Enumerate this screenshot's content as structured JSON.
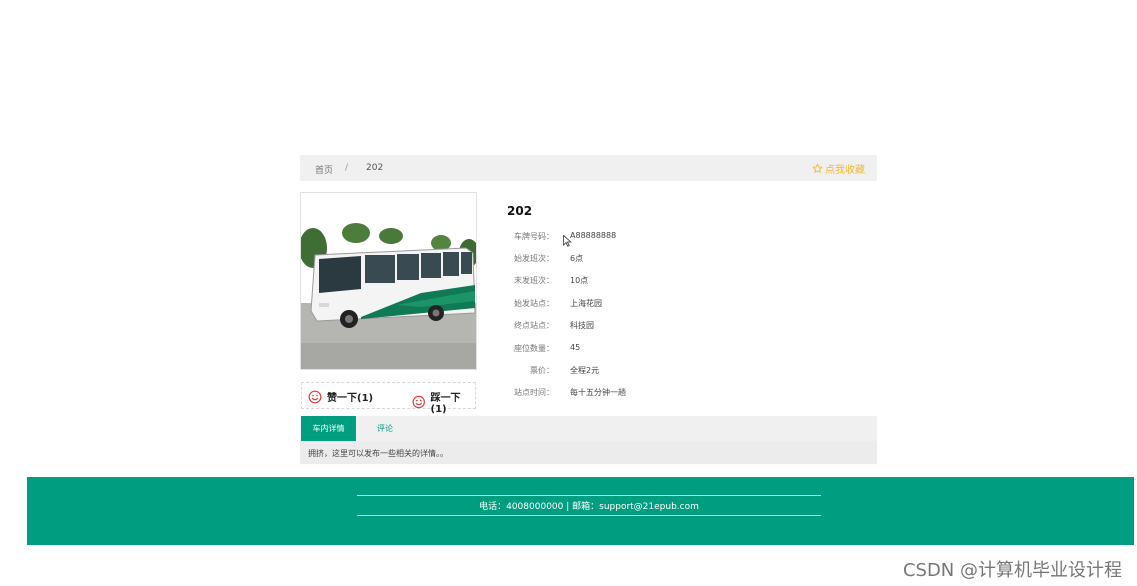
{
  "breadcrumb": {
    "home": "首页",
    "separator": "/",
    "current": "202"
  },
  "favorite": {
    "label": "点我收藏",
    "icon": "star-outline-icon",
    "color": "#f3b72f"
  },
  "photo": {
    "alt": "bus-photo"
  },
  "votes": {
    "like_label": "赞一下(1)",
    "dislike_label": "踩一下(1)",
    "icon": "smiley-icon",
    "icon_color": "#e53935"
  },
  "detail": {
    "title": "202",
    "fields": [
      {
        "label": "车牌号码：",
        "value": "A88888888"
      },
      {
        "label": "始发班次：",
        "value": "6点"
      },
      {
        "label": "末发班次：",
        "value": "10点"
      },
      {
        "label": "始发站点：",
        "value": "上海花园"
      },
      {
        "label": "终点站点：",
        "value": "科技园"
      },
      {
        "label": "座位数量：",
        "value": "45"
      },
      {
        "label": "票价：",
        "value": "全程2元"
      },
      {
        "label": "站点时间：",
        "value": "每十五分钟一趟"
      }
    ]
  },
  "tabs": [
    {
      "label": "车内详情",
      "active": true
    },
    {
      "label": "评论",
      "active": false
    }
  ],
  "tab_content": "拥挤，这里可以发布一些相关的详情。。",
  "footer": {
    "contact": "电话：4008000000 | 邮箱：support@21epub.com"
  },
  "watermark": "CSDN @计算机毕业设计程",
  "colors": {
    "accent": "#009e80",
    "light_bg": "#f0f0f0"
  }
}
